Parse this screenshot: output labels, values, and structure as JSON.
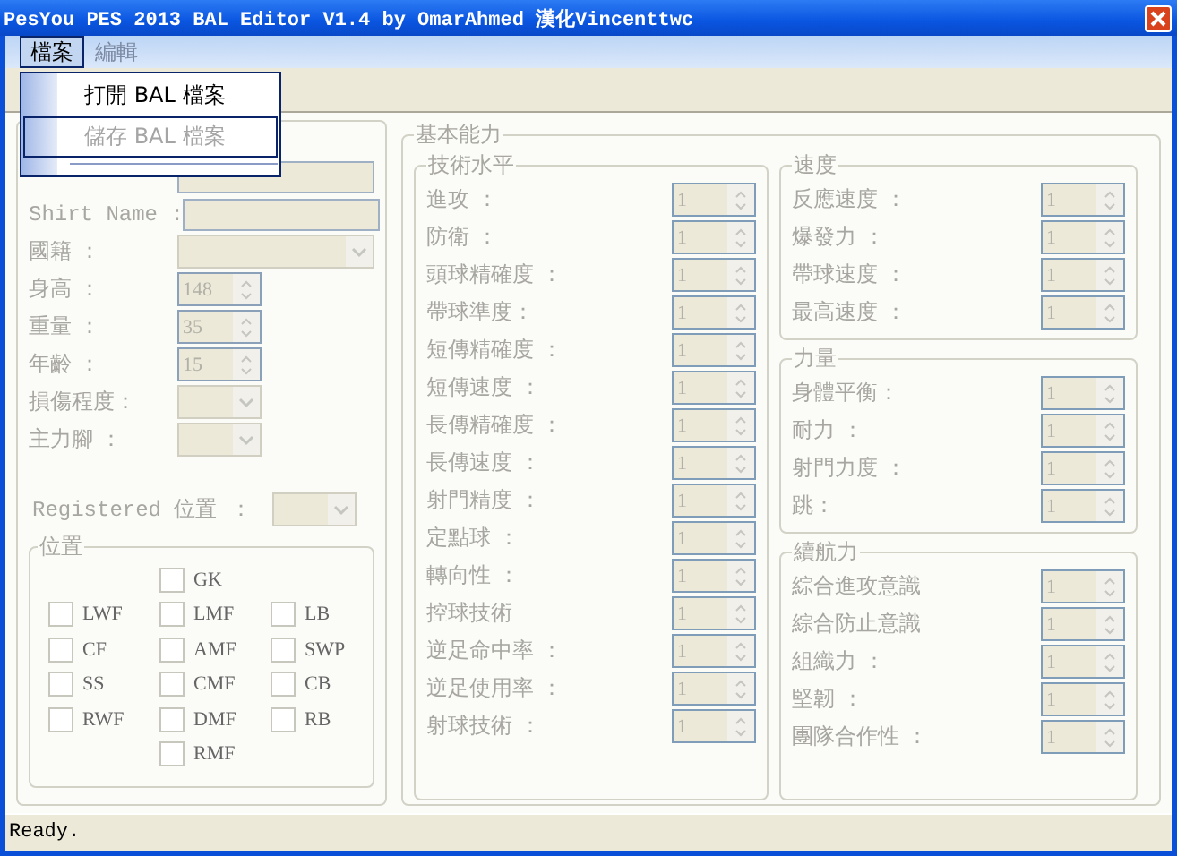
{
  "window": {
    "title": "PesYou PES 2013 BAL Editor V1.4 by OmarAhmed  漢化Vincenttwc"
  },
  "menu_bar": [
    {
      "label": "檔案",
      "selected": true,
      "disabled": false
    },
    {
      "label": "編輯",
      "selected": false,
      "disabled": true
    }
  ],
  "open_menu": {
    "items": [
      {
        "label": "打開 BAL 檔案",
        "disabled": false,
        "selected": false
      },
      {
        "label": "儲存 BAL 檔案",
        "disabled": true,
        "selected": true
      }
    ]
  },
  "player": {
    "fields": [
      {
        "kind": "text"
      },
      {
        "kind": "text",
        "label": "Shirt Name :"
      },
      {
        "kind": "combo",
        "label": "國籍 ："
      },
      {
        "kind": "spin",
        "label": "身高 ：",
        "value": "148"
      },
      {
        "kind": "spin",
        "label": "重量 ：",
        "value": "35"
      },
      {
        "kind": "spin",
        "label": "年齡 ：",
        "value": "15"
      },
      {
        "kind": "combo",
        "label": "損傷程度："
      },
      {
        "kind": "combo",
        "label": "主力腳 ："
      }
    ],
    "registered_position": {
      "label": "Registered 位置 ：",
      "kind": "combo"
    },
    "positions": {
      "title": "位置",
      "columns": [
        [
          null,
          {
            "label": "LWF",
            "checked": false
          },
          {
            "label": "CF",
            "checked": false
          },
          {
            "label": "SS",
            "checked": false
          },
          {
            "label": "RWF",
            "checked": false
          }
        ],
        [
          {
            "label": "GK",
            "checked": false
          },
          {
            "label": "LMF",
            "checked": false
          },
          {
            "label": "AMF",
            "checked": false
          },
          {
            "label": "CMF",
            "checked": false
          },
          {
            "label": "DMF",
            "checked": false
          },
          {
            "label": "RMF",
            "checked": false
          }
        ],
        [
          null,
          {
            "label": "LB",
            "checked": false
          },
          {
            "label": "SWP",
            "checked": false
          },
          {
            "label": "CB",
            "checked": false
          },
          {
            "label": "RB",
            "checked": false
          }
        ]
      ]
    }
  },
  "abilities": {
    "title": "基本能力",
    "groups": [
      {
        "title": "技術水平",
        "rows": [
          {
            "label": "進攻 ：",
            "value": "1"
          },
          {
            "label": "防衛 ：",
            "value": "1"
          },
          {
            "label": "頭球精確度 ：",
            "value": "1"
          },
          {
            "label": "帶球準度：",
            "value": "1"
          },
          {
            "label": "短傳精確度 ：",
            "value": "1"
          },
          {
            "label": "短傳速度 ：",
            "value": "1"
          },
          {
            "label": "長傳精確度 ：",
            "value": "1"
          },
          {
            "label": "長傳速度 ：",
            "value": "1"
          },
          {
            "label": "射門精度 ：",
            "value": "1"
          },
          {
            "label": "定點球 ：",
            "value": "1"
          },
          {
            "label": "轉向性 ：",
            "value": "1"
          },
          {
            "label": "控球技術",
            "value": "1"
          },
          {
            "label": "逆足命中率 ：",
            "value": "1"
          },
          {
            "label": "逆足使用率 ：",
            "value": "1"
          },
          {
            "label": "射球技術 ：",
            "value": "1"
          }
        ]
      },
      {
        "title": "速度",
        "rows": [
          {
            "label": "反應速度 ：",
            "value": "1"
          },
          {
            "label": "爆發力 ：",
            "value": "1"
          },
          {
            "label": "帶球速度 ：",
            "value": "1"
          },
          {
            "label": "最高速度 ：",
            "value": "1"
          }
        ]
      },
      {
        "title": "力量",
        "rows": [
          {
            "label": "身體平衡：",
            "value": "1"
          },
          {
            "label": "耐力 ：",
            "value": "1"
          },
          {
            "label": "射門力度 ：",
            "value": "1"
          },
          {
            "label": "跳：",
            "value": "1"
          }
        ]
      },
      {
        "title": "續航力",
        "rows": [
          {
            "label": "綜合進攻意識",
            "value": "1"
          },
          {
            "label": "綜合防止意識",
            "value": "1"
          },
          {
            "label": "組織力 ：",
            "value": "1"
          },
          {
            "label": "堅韌 ：",
            "value": "1"
          },
          {
            "label": "團隊合作性 ：",
            "value": "1"
          }
        ]
      }
    ]
  },
  "status_bar": {
    "text": "Ready."
  }
}
